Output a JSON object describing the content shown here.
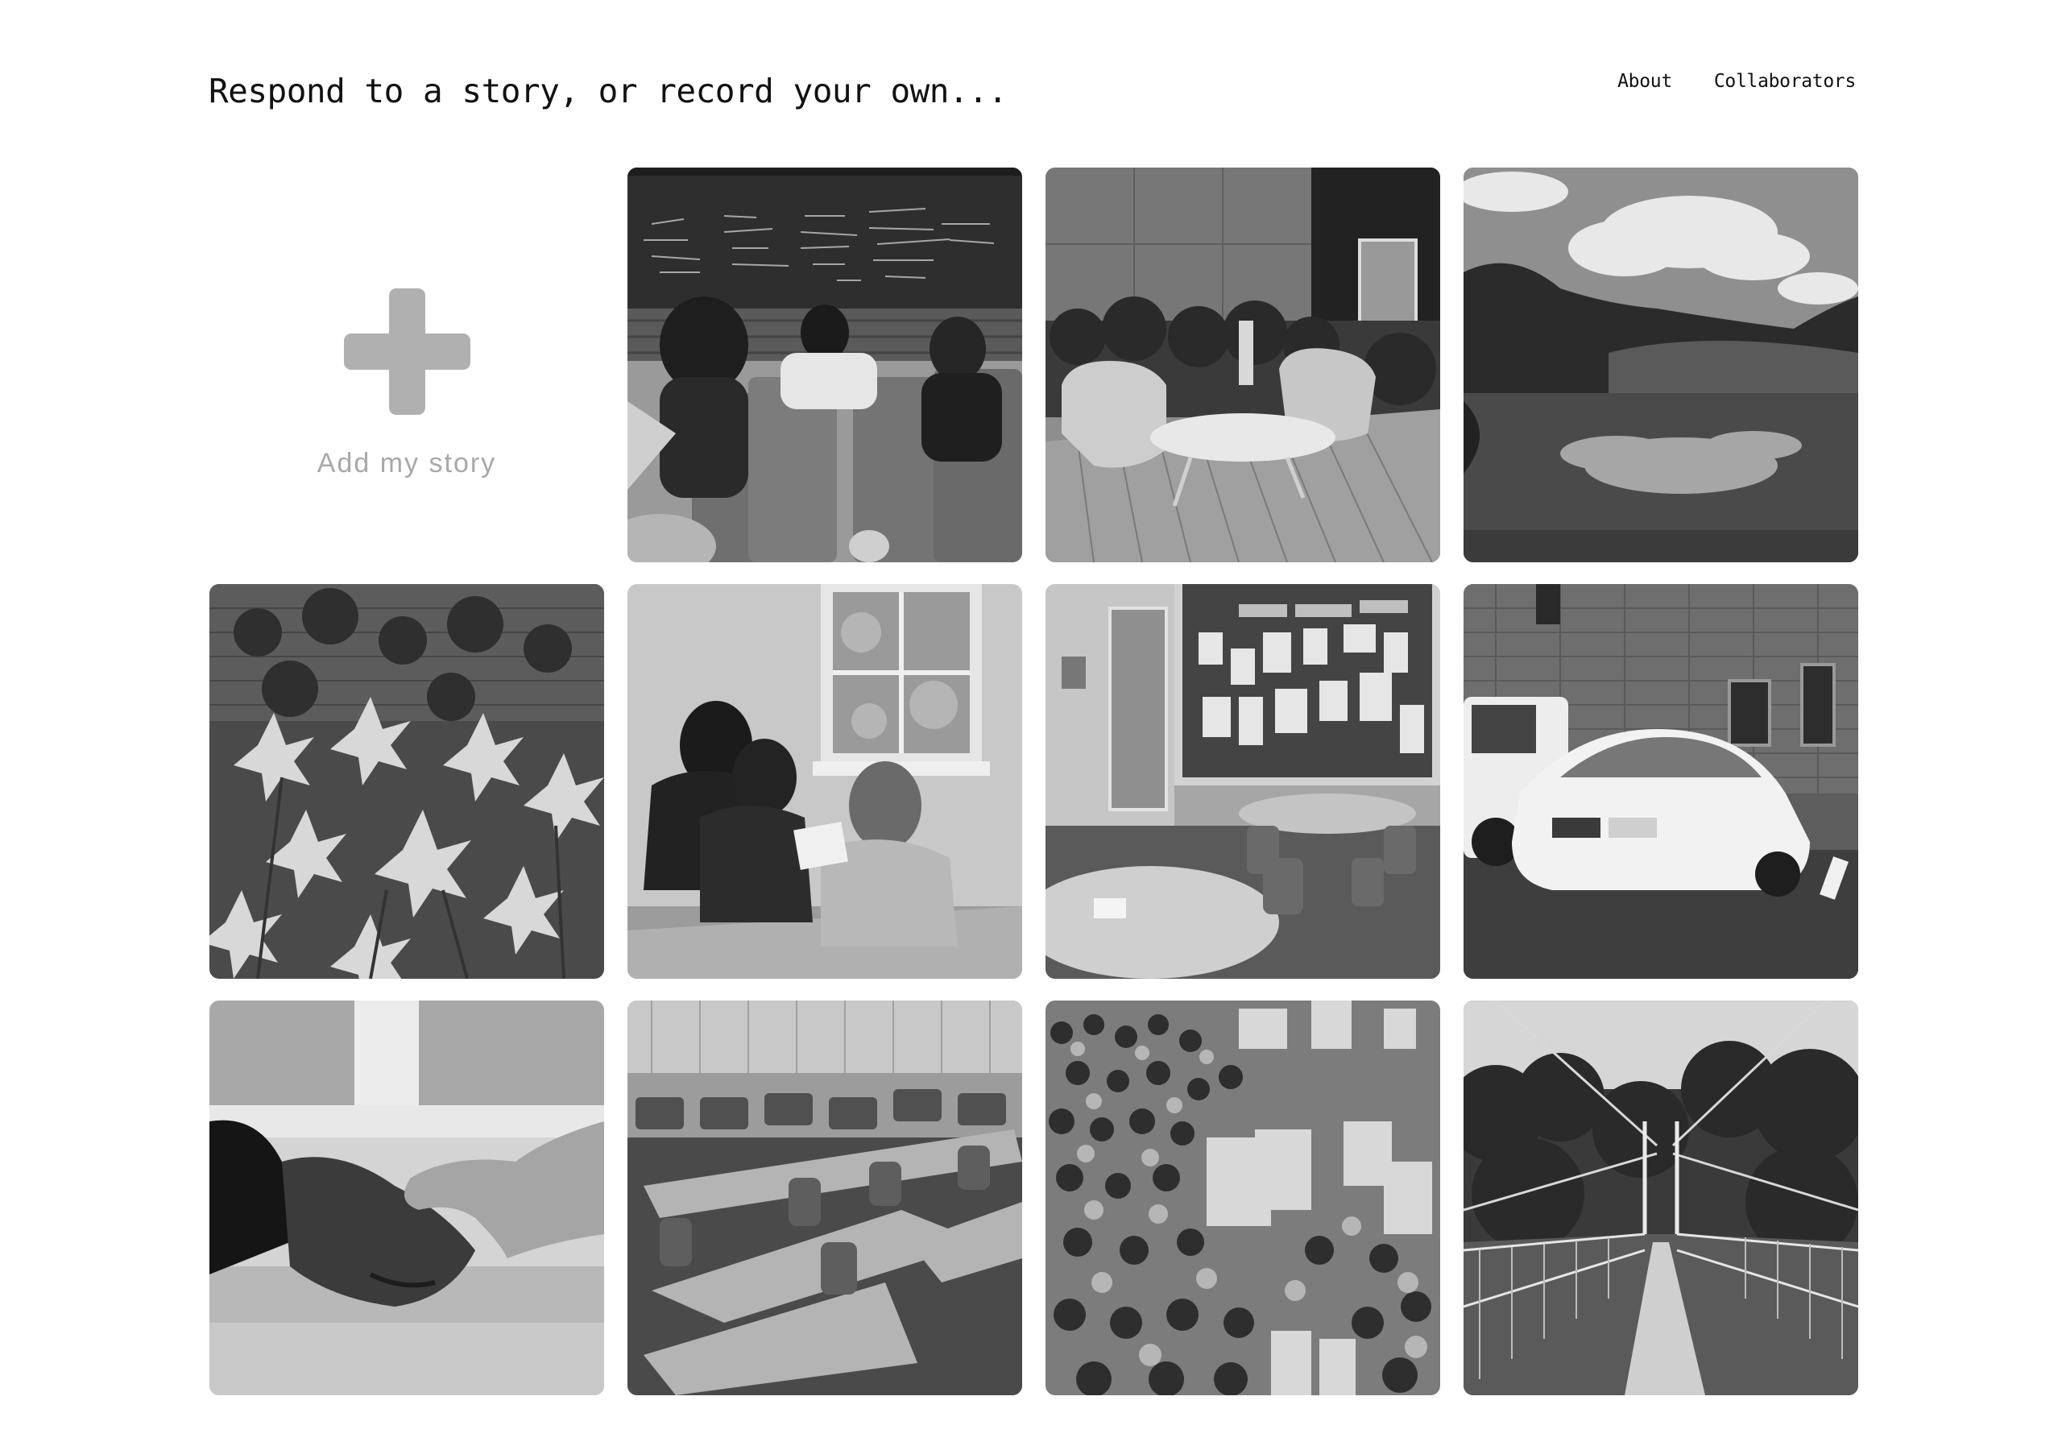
{
  "header": {
    "title": "Respond to a story, or record your own...",
    "nav": [
      {
        "label": "About"
      },
      {
        "label": "Collaborators"
      }
    ]
  },
  "add_story": {
    "label": "Add my story",
    "icon": "plus-icon"
  },
  "stories": [
    {
      "subject": "lecture-hall"
    },
    {
      "subject": "patio-chairs"
    },
    {
      "subject": "pond-landscape"
    },
    {
      "subject": "lily-flowers"
    },
    {
      "subject": "students-by-window"
    },
    {
      "subject": "study-room"
    },
    {
      "subject": "police-car"
    },
    {
      "subject": "handshake"
    },
    {
      "subject": "classroom-tables"
    },
    {
      "subject": "crowd-fair"
    },
    {
      "subject": "suspension-bridge"
    }
  ],
  "colors": {
    "text": "#111111",
    "muted": "#a8a8a8",
    "plus": "#b0b0b0",
    "background": "#ffffff"
  }
}
